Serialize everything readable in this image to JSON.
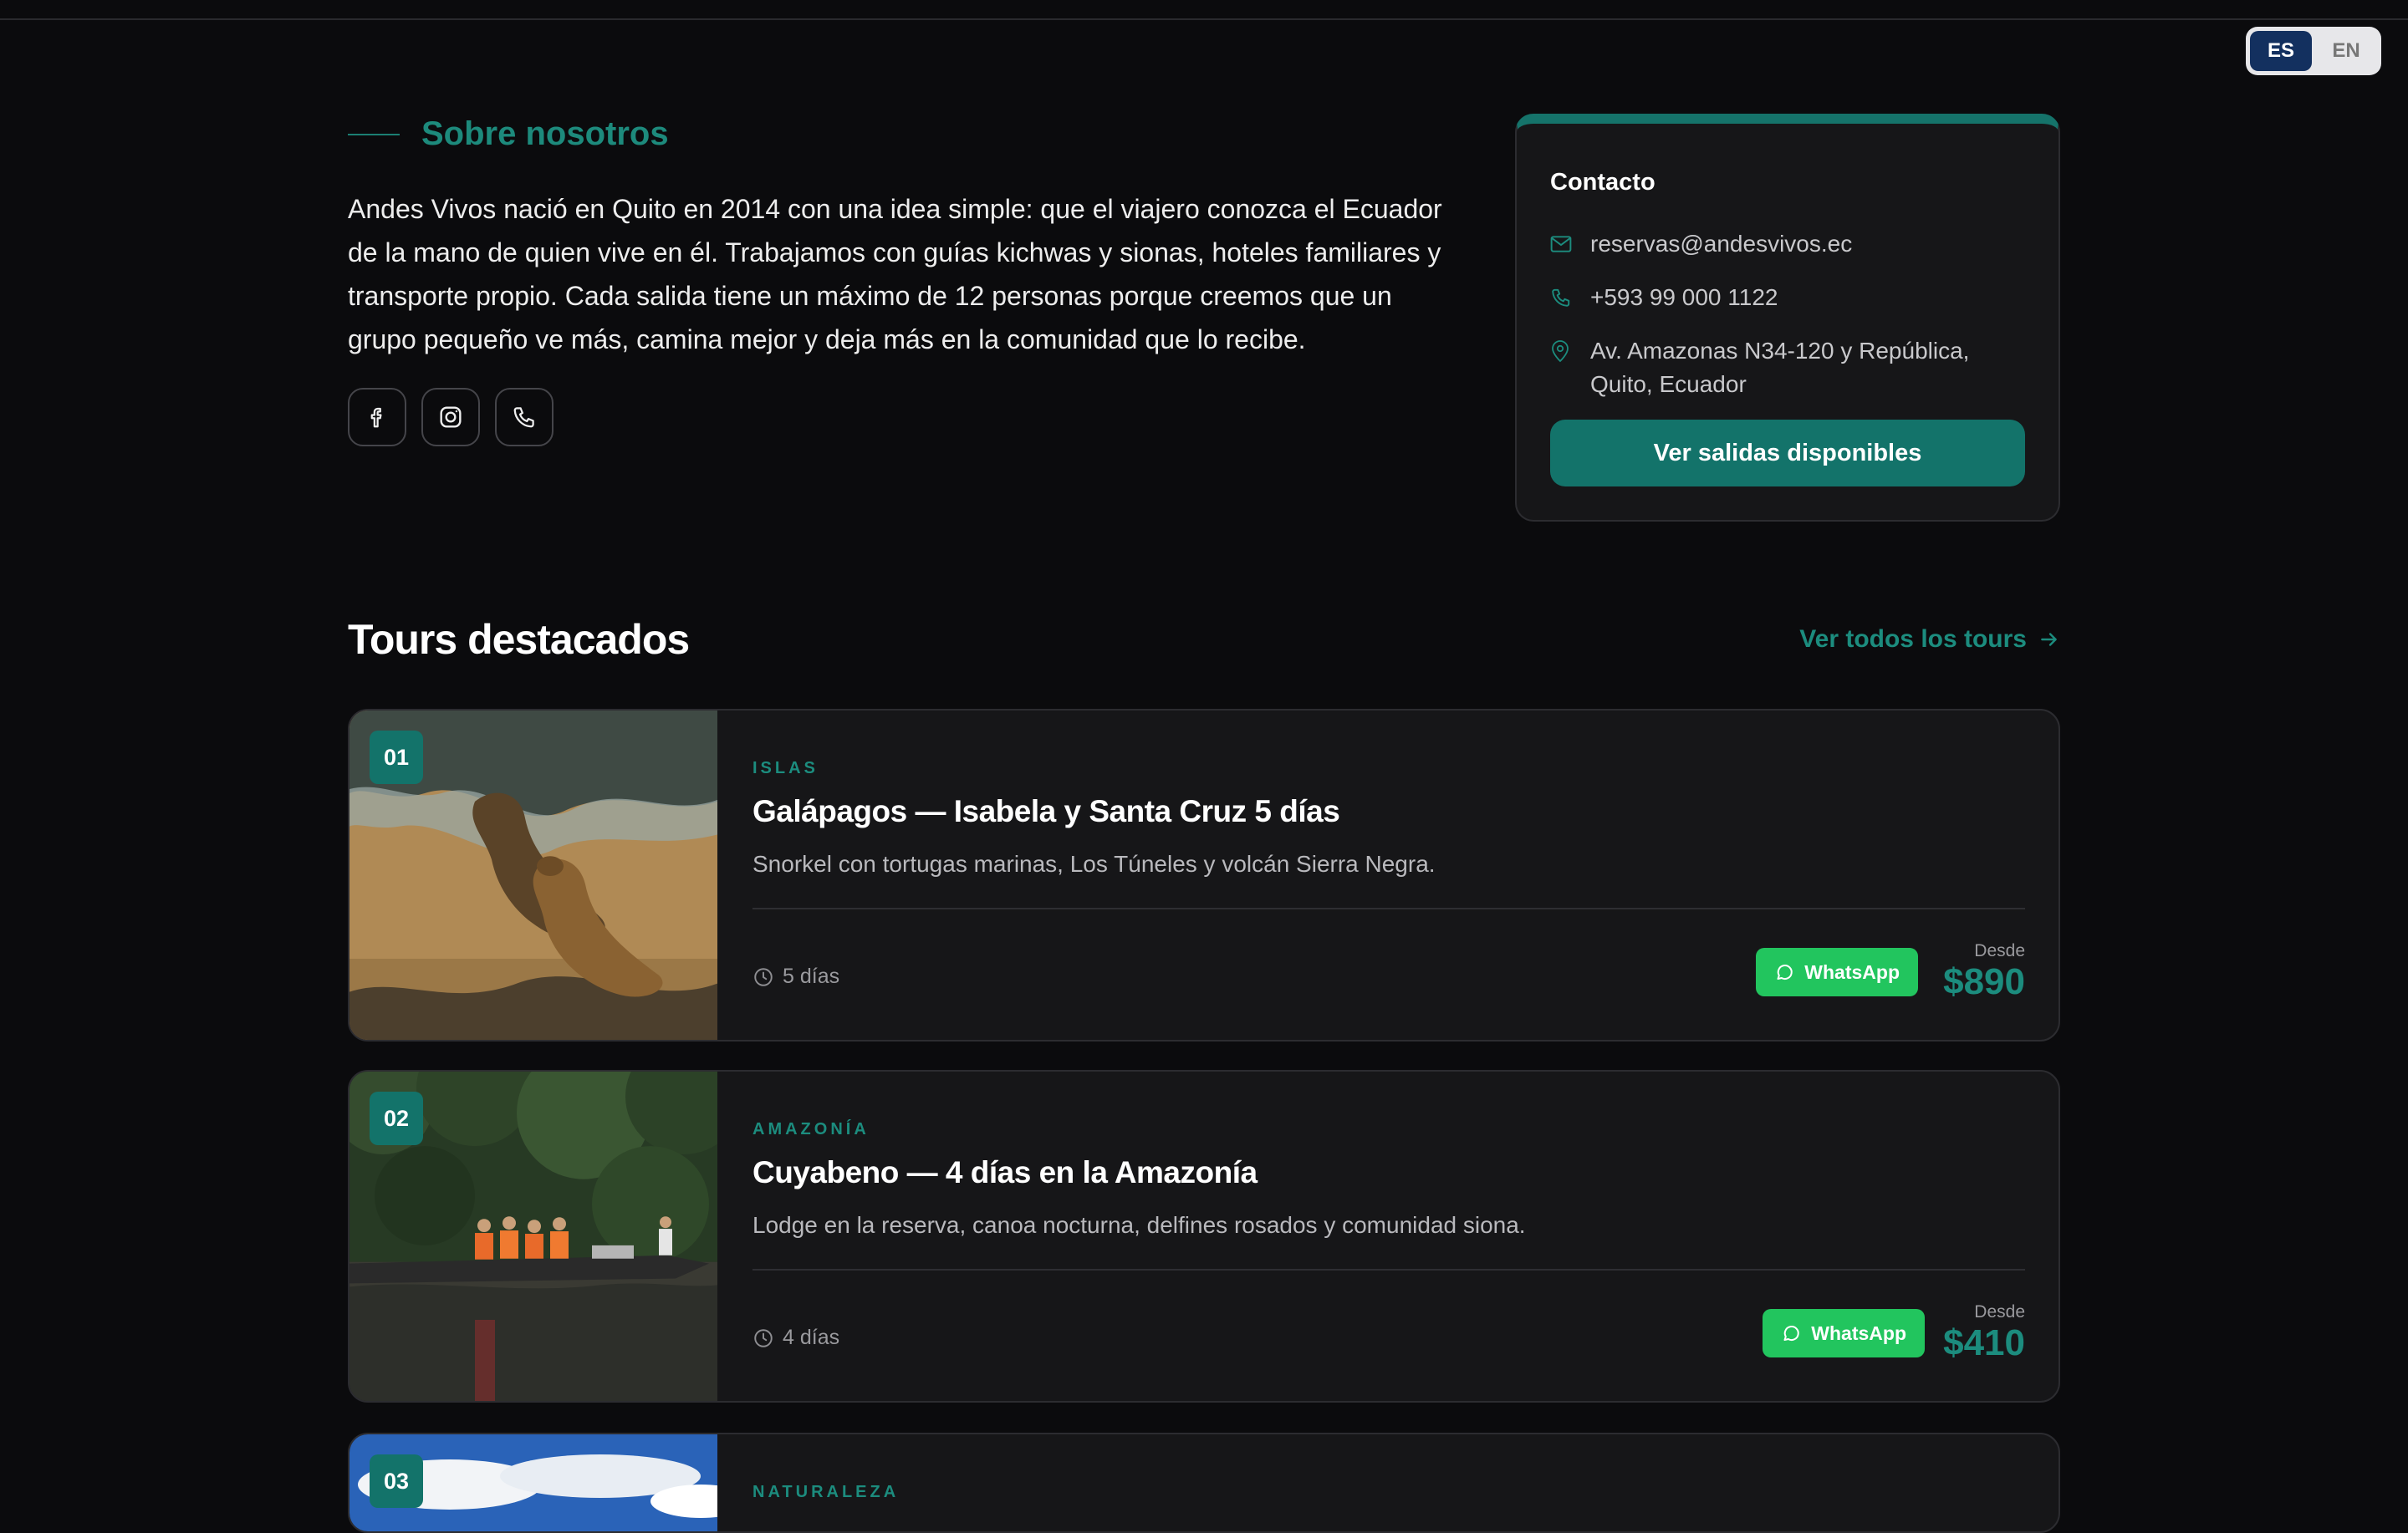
{
  "language": {
    "options": [
      "ES",
      "EN"
    ],
    "active": "ES"
  },
  "about": {
    "heading": "Sobre nosotros",
    "body": "Andes Vivos nació en Quito en 2014 con una idea simple: que el viajero conozca el Ecuador de la mano de quien vive en él. Trabajamos con guías kichwas y sionas, hoteles familiares y transporte propio. Cada salida tiene un máximo de 12 personas porque creemos que un grupo pequeño ve más, camina mejor y deja más en la comunidad que lo recibe.",
    "social_icons": [
      "facebook-icon",
      "instagram-icon",
      "phone-icon"
    ]
  },
  "contact": {
    "title": "Contacto",
    "email": "reservas@andesvivos.ec",
    "phone": "+593 99 000 1122",
    "address_line1": "Av. Amazonas N34-120 y República,",
    "address_line2": "Quito, Ecuador",
    "cta": "Ver salidas disponibles"
  },
  "tours_section": {
    "title": "Tours destacados",
    "see_all": "Ver todos los tours"
  },
  "tours": [
    {
      "num": "01",
      "category": "ISLAS",
      "name": "Galápagos — Isabela y Santa Cruz 5 días",
      "desc": "Snorkel con tortugas marinas, Los Túneles y volcán Sierra Negra.",
      "duration": "5 días",
      "whatsapp": "WhatsApp",
      "from_label": "Desde",
      "price": "$890"
    },
    {
      "num": "02",
      "category": "AMAZONÍA",
      "name": "Cuyabeno — 4 días en la Amazonía",
      "desc": "Lodge en la reserva, canoa nocturna, delfines rosados y comunidad siona.",
      "duration": "4 días",
      "whatsapp": "WhatsApp",
      "from_label": "Desde",
      "price": "$410"
    },
    {
      "num": "03",
      "category": "NATURALEZA"
    }
  ],
  "colors": {
    "accent": "#13736a",
    "accent_text": "#1c8c7e",
    "whatsapp": "#22c55e",
    "lang_active": "#13305f",
    "background": "#0b0b0d"
  }
}
